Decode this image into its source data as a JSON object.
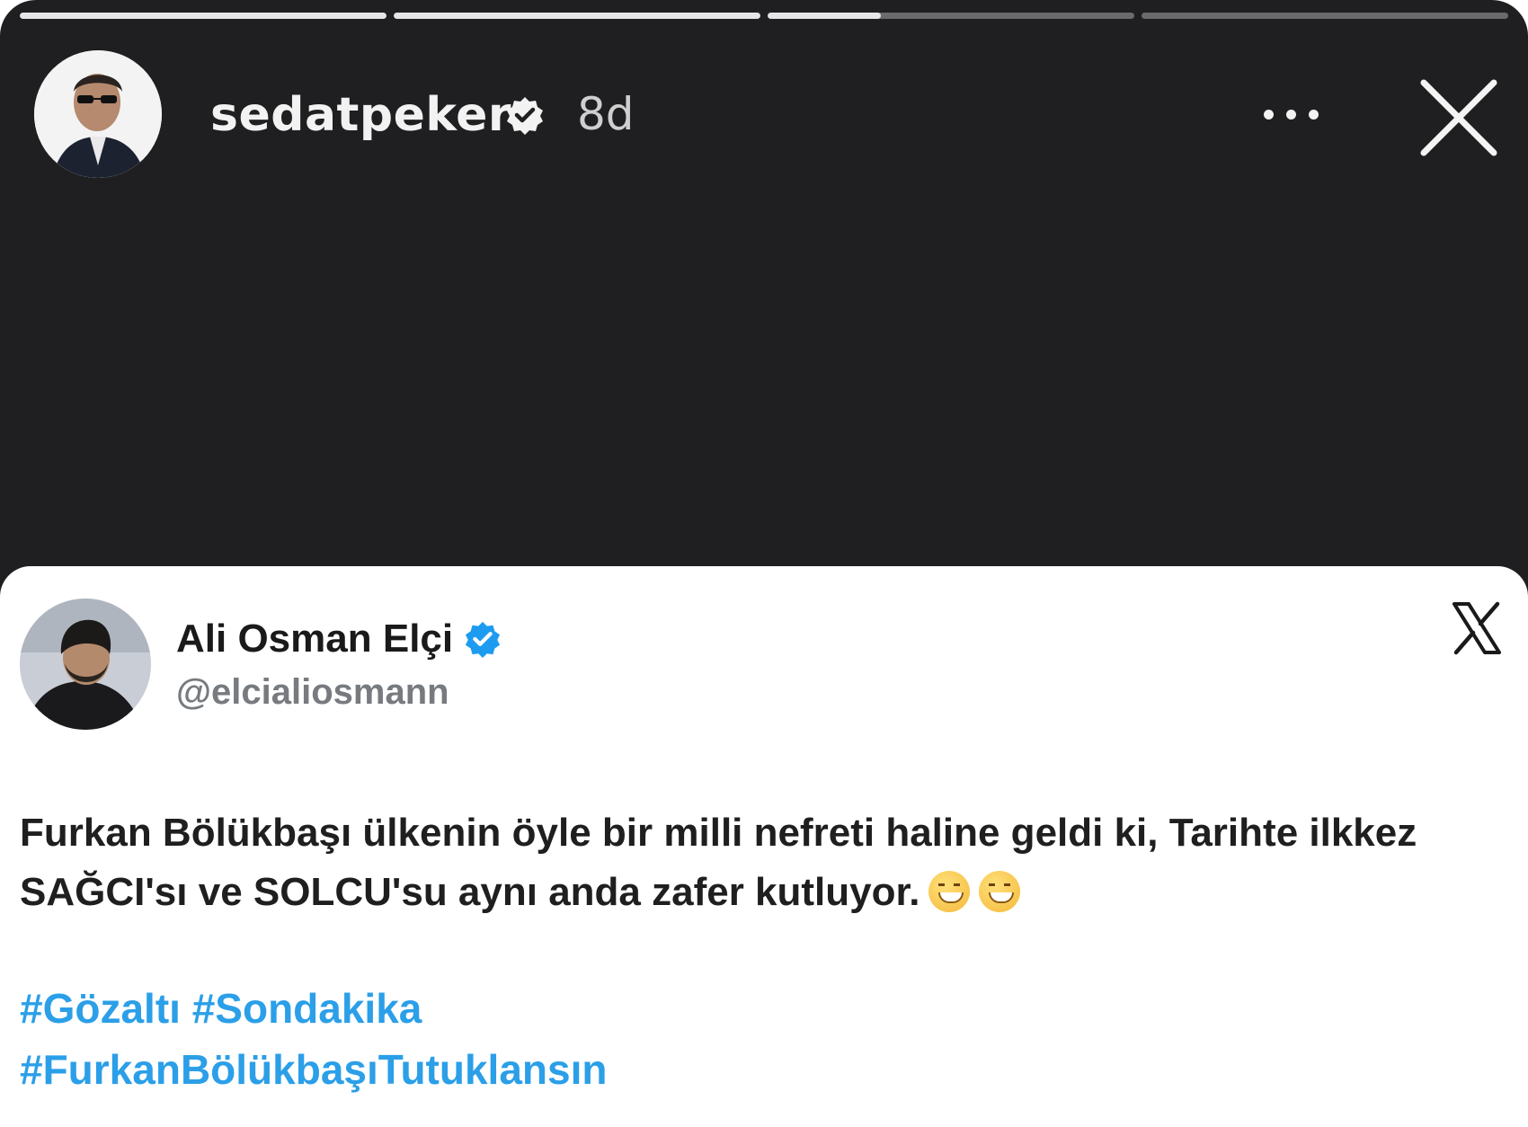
{
  "story": {
    "username": "sedatpeker",
    "time_ago": "8d",
    "progress": [
      1.0,
      1.0,
      0.31,
      0.0
    ],
    "more_icon": "more-horizontal-icon",
    "close_icon": "close-icon"
  },
  "tweet": {
    "display_name": "Ali Osman Elçi",
    "handle": "@elcialiosmann",
    "text": "Furkan Bölükbaşı ülkenin öyle bir milli nefreti haline geldi ki, Tarihte ilkkez SAĞCI'sı ve SOLCU'su aynı anda zafer kutluyor.",
    "hashtags_line1": "#Gözaltı #Sondakika",
    "hashtags_line2": "#FurkanBölükbaşıTutuklansın",
    "platform_icon": "x-logo-icon",
    "verified_icon": "verified-badge-icon"
  },
  "colors": {
    "story_bg": "#1f1f21",
    "hashtag": "#2b9fe8",
    "verified_blue": "#1d9bf0"
  }
}
